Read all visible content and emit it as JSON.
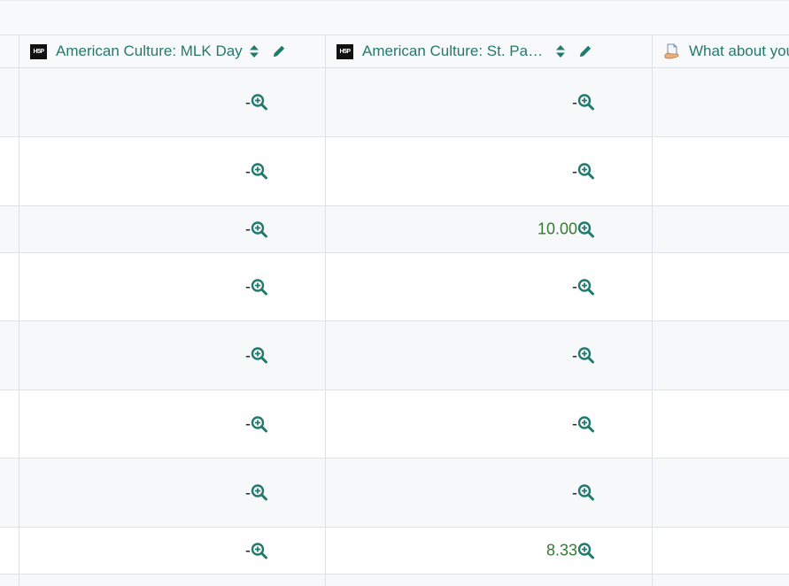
{
  "columns": [
    {
      "title": "American Culture: MLK Day",
      "icon": "h5p-icon",
      "sortable": true,
      "editable": true
    },
    {
      "title": "American Culture: St. Pat…",
      "icon": "h5p-icon",
      "sortable": true,
      "editable": true
    },
    {
      "title": "What about you",
      "icon": "assignment-icon",
      "sortable": false,
      "editable": false
    }
  ],
  "h5p_icon_text": "H5P",
  "rows": [
    {
      "mlk": "-",
      "stpat": "-"
    },
    {
      "mlk": "-",
      "stpat": "-"
    },
    {
      "mlk": "-",
      "stpat": "10.00"
    },
    {
      "mlk": "-",
      "stpat": "-"
    },
    {
      "mlk": "-",
      "stpat": "-"
    },
    {
      "mlk": "-",
      "stpat": "-"
    },
    {
      "mlk": "-",
      "stpat": "-"
    },
    {
      "mlk": "-",
      "stpat": "8.33"
    }
  ],
  "colors": {
    "link": "#227a6d",
    "grade": "#357a32",
    "shaded_row": "#f7f8f9",
    "border": "#dee2e6"
  }
}
